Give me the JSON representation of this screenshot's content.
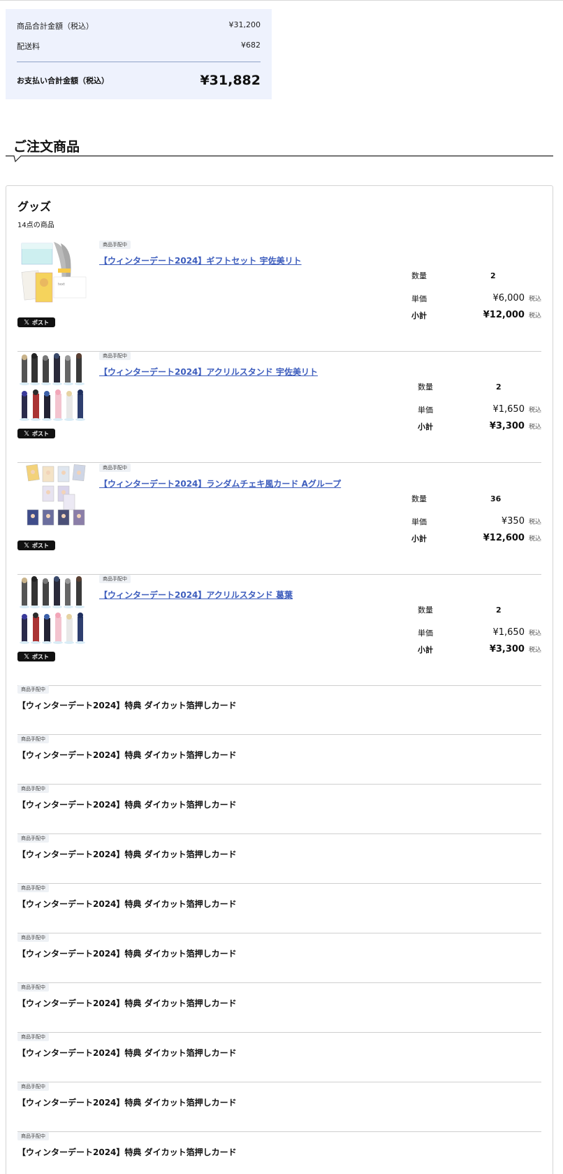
{
  "summary": {
    "subtotal_label": "商品合計金額（税込）",
    "subtotal_value": "¥31,200",
    "shipping_label": "配送料",
    "shipping_value": "¥682",
    "total_label": "お支払い合計金額（税込）",
    "total_value": "¥31,882"
  },
  "section_title": "ご注文商品",
  "category": {
    "title": "グッズ",
    "count": "14点の商品"
  },
  "labels": {
    "status": "商品手配中",
    "post": "ポスト",
    "qty": "数量",
    "unit_price": "単価",
    "subtotal": "小計",
    "tax": "税込"
  },
  "items": [
    {
      "status": "商品手配中",
      "name": "【ウィンターデート2024】ギフトセット 宇佐美リト",
      "qty": "2",
      "unit_price": "¥6,000",
      "subtotal": "¥12,000",
      "thumb": "gift-set-image"
    },
    {
      "status": "商品手配中",
      "name": "【ウィンターデート2024】アクリルスタンド 宇佐美リト",
      "qty": "2",
      "unit_price": "¥1,650",
      "subtotal": "¥3,300",
      "thumb": "acrylic-stand-image"
    },
    {
      "status": "商品手配中",
      "name": "【ウィンターデート2024】ランダムチェキ風カード Aグループ",
      "qty": "36",
      "unit_price": "¥350",
      "subtotal": "¥12,600",
      "thumb": "cheki-card-image"
    },
    {
      "status": "商品手配中",
      "name": "【ウィンターデート2024】アクリルスタンド 葛葉",
      "qty": "2",
      "unit_price": "¥1,650",
      "subtotal": "¥3,300",
      "thumb": "acrylic-stand-image"
    }
  ],
  "bonus_items": [
    {
      "status": "商品手配中",
      "name": "【ウィンターデート2024】特典 ダイカット箔押しカード"
    },
    {
      "status": "商品手配中",
      "name": "【ウィンターデート2024】特典 ダイカット箔押しカード"
    },
    {
      "status": "商品手配中",
      "name": "【ウィンターデート2024】特典 ダイカット箔押しカード"
    },
    {
      "status": "商品手配中",
      "name": "【ウィンターデート2024】特典 ダイカット箔押しカード"
    },
    {
      "status": "商品手配中",
      "name": "【ウィンターデート2024】特典 ダイカット箔押しカード"
    },
    {
      "status": "商品手配中",
      "name": "【ウィンターデート2024】特典 ダイカット箔押しカード"
    },
    {
      "status": "商品手配中",
      "name": "【ウィンターデート2024】特典 ダイカット箔押しカード"
    },
    {
      "status": "商品手配中",
      "name": "【ウィンターデート2024】特典 ダイカット箔押しカード"
    },
    {
      "status": "商品手配中",
      "name": "【ウィンターデート2024】特典 ダイカット箔押しカード"
    },
    {
      "status": "商品手配中",
      "name": "【ウィンターデート2024】特典 ダイカット箔押しカード"
    }
  ],
  "colors": {
    "summary_bg": "#eef2fd",
    "link": "#3d5dbd",
    "badge_bg": "#eef1f5"
  }
}
